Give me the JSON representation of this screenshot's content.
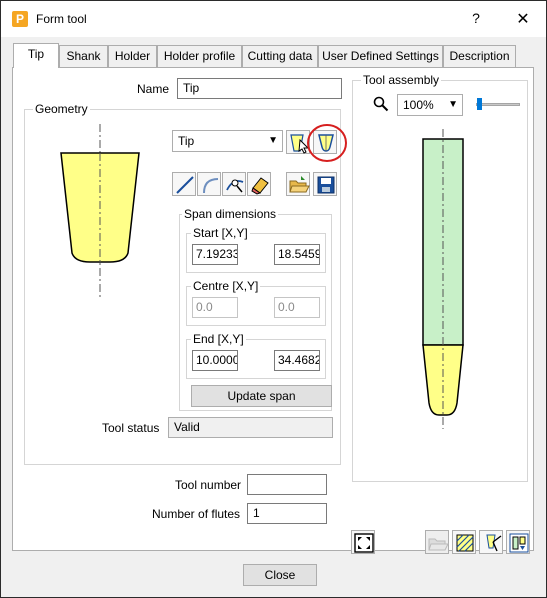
{
  "window": {
    "title": "Form tool",
    "icon_letter": "P",
    "help": "?",
    "close": "✕"
  },
  "tabs": [
    {
      "label": "Tip",
      "active": true
    },
    {
      "label": "Shank"
    },
    {
      "label": "Holder"
    },
    {
      "label": "Holder profile"
    },
    {
      "label": "Cutting data"
    },
    {
      "label": "User Defined Settings"
    },
    {
      "label": "Description"
    }
  ],
  "name": {
    "label": "Name",
    "value": "Tip"
  },
  "geometry": {
    "title": "Geometry",
    "profile_select": "Tip",
    "span_dimensions": {
      "title": "Span dimensions",
      "start": {
        "label": "Start [X,Y]",
        "x": "7.19233",
        "y": "18.5459"
      },
      "centre": {
        "label": "Centre [X,Y]",
        "x": "0.0",
        "y": "0.0"
      },
      "end": {
        "label": "End [X,Y]",
        "x": "10.0000",
        "y": "34.4682"
      },
      "update_button": "Update span"
    },
    "tool_status": {
      "label": "Tool status",
      "value": "Valid"
    }
  },
  "tool_number": {
    "label": "Tool number",
    "value": ""
  },
  "number_of_flutes": {
    "label": "Number of flutes",
    "value": "1"
  },
  "tool_assembly": {
    "title": "Tool assembly",
    "zoom": "100%",
    "zoom_slider": 0.03
  },
  "footer": {
    "close_button": "Close"
  },
  "colors": {
    "tip_fill": "#ffff88",
    "shank_fill": "#c8f0c8",
    "highlight_circle": "#d61f1f",
    "accent": "#0078d7"
  }
}
